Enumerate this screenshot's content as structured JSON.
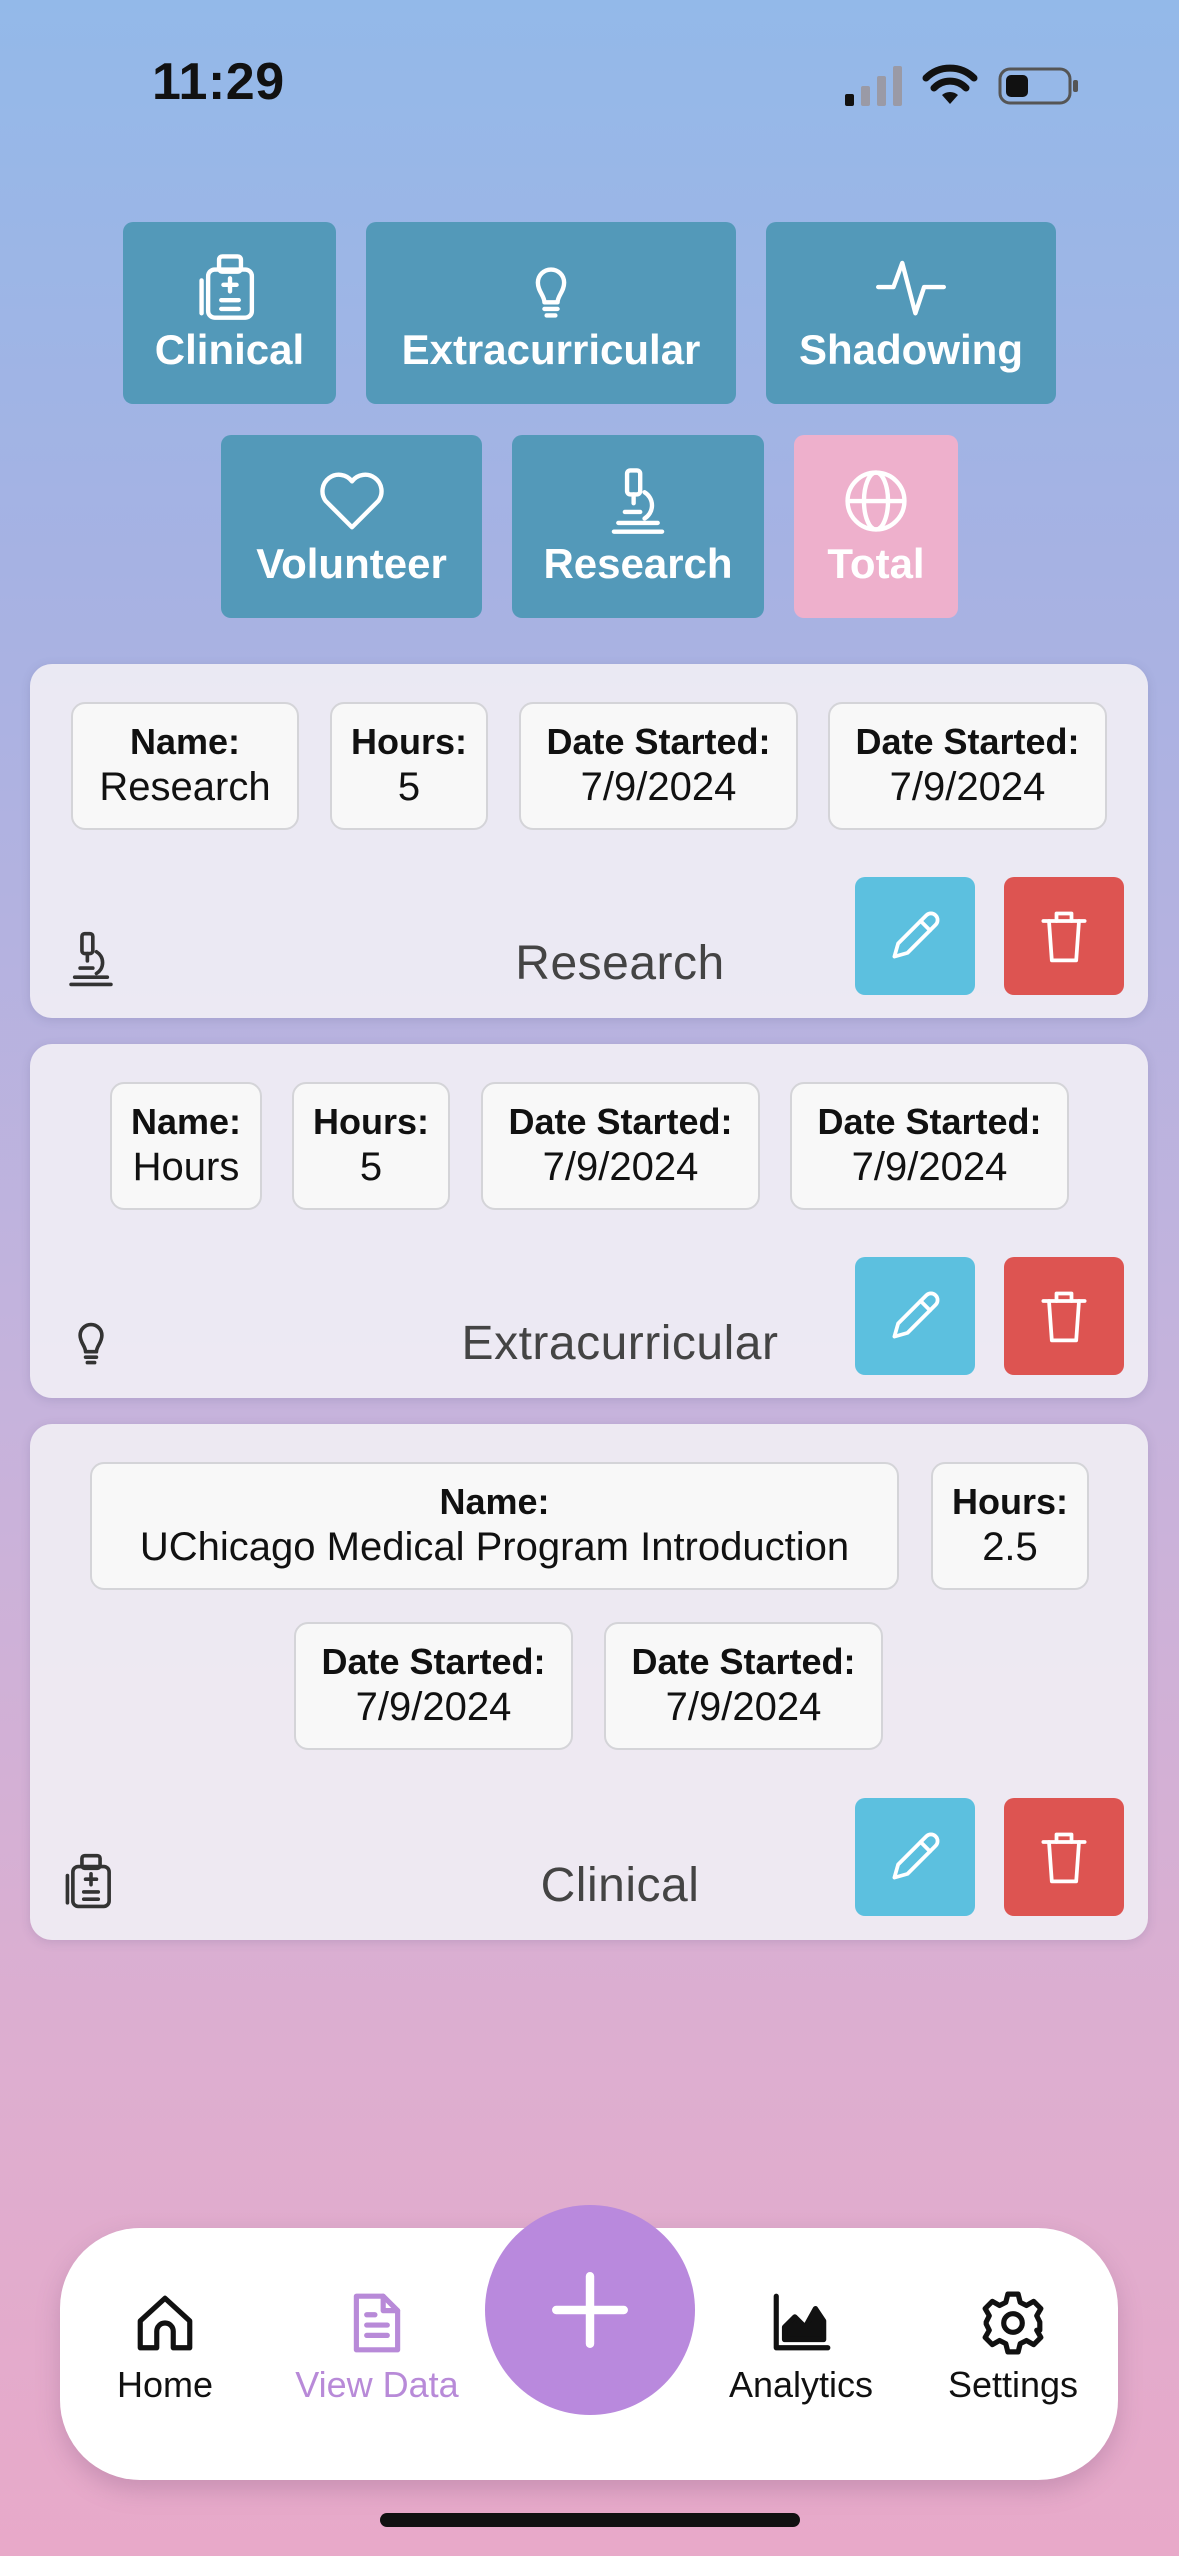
{
  "status_bar": {
    "time": "11:29"
  },
  "categories": [
    {
      "label": "Clinical",
      "icon": "clinical-clipboard-icon"
    },
    {
      "label": "Extracurricular",
      "icon": "lightbulb-icon"
    },
    {
      "label": "Shadowing",
      "icon": "pulse-icon"
    },
    {
      "label": "Volunteer",
      "icon": "heart-icon"
    },
    {
      "label": "Research",
      "icon": "microscope-icon"
    },
    {
      "label": "Total",
      "icon": "globe-icon"
    }
  ],
  "records": [
    {
      "name_label": "Name:",
      "name": "Research",
      "hours_label": "Hours:",
      "hours": "5",
      "date1_label": "Date Started:",
      "date1": "7/9/2024",
      "date2_label": "Date Started:",
      "date2": "7/9/2024",
      "type": "Research",
      "icon": "microscope-icon"
    },
    {
      "name_label": "Name:",
      "name": "Hours",
      "hours_label": "Hours:",
      "hours": "5",
      "date1_label": "Date Started:",
      "date1": "7/9/2024",
      "date2_label": "Date Started:",
      "date2": "7/9/2024",
      "type": "Extracurricular",
      "icon": "lightbulb-icon"
    },
    {
      "name_label": "Name:",
      "name": "UChicago Medical Program Introduction",
      "hours_label": "Hours:",
      "hours": "2.5",
      "date1_label": "Date Started:",
      "date1": "7/9/2024",
      "date2_label": "Date Started:",
      "date2": "7/9/2024",
      "type": "Clinical",
      "icon": "clinical-clipboard-icon"
    }
  ],
  "tab_bar": {
    "home": "Home",
    "view_data": "View Data",
    "analytics": "Analytics",
    "settings": "Settings",
    "active_tab": "View Data"
  },
  "colors": {
    "category_button": "#5399b9",
    "total_button": "#eeb0cc",
    "edit_button": "#5cc0df",
    "delete_button": "#dd5451",
    "fab": "#b989dd",
    "active_tab": "#b88ad8"
  }
}
